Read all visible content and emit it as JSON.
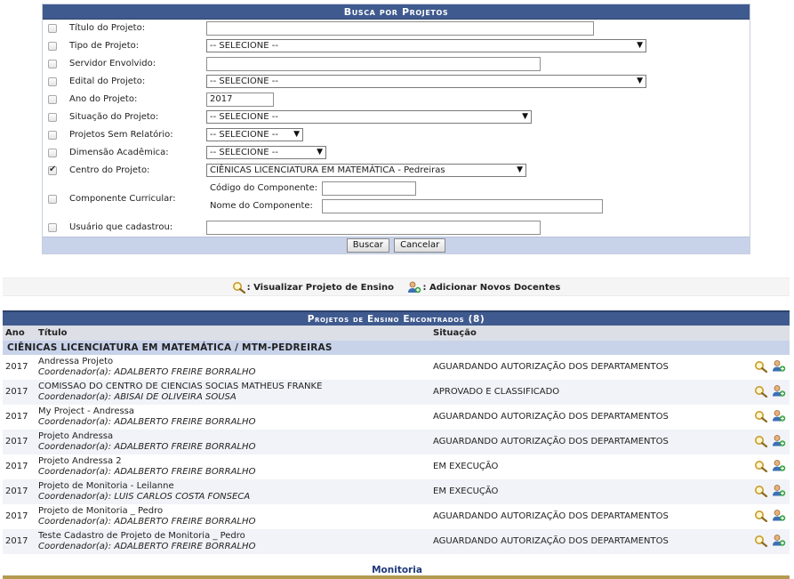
{
  "form": {
    "title": "Busca por Projetos",
    "fields": {
      "titulo": {
        "label": "Título do Projeto:",
        "value": ""
      },
      "tipo": {
        "label": "Tipo de Projeto:",
        "value": "-- SELECIONE --"
      },
      "servidor": {
        "label": "Servidor Envolvido:",
        "value": ""
      },
      "edital": {
        "label": "Edital do Projeto:",
        "value": "-- SELECIONE --"
      },
      "ano": {
        "label": "Ano do Projeto:",
        "value": "2017"
      },
      "situacao": {
        "label": "Situação do Projeto:",
        "value": "-- SELECIONE --"
      },
      "sem_relatorio": {
        "label": "Projetos Sem Relatório:",
        "value": "-- SELECIONE --"
      },
      "dimensao": {
        "label": "Dimensão Acadêmica:",
        "value": "-- SELECIONE --"
      },
      "centro": {
        "label": "Centro do Projeto:",
        "value": "CIÊNICAS LICENCIATURA EM MATEMÁTICA - Pedreiras",
        "checked": true
      },
      "componente": {
        "label": "Componente Curricular:",
        "codigo_label": "Código do Componente:",
        "nome_label": "Nome do Componente:"
      },
      "usuario": {
        "label": "Usuário que cadastrou:",
        "value": ""
      }
    },
    "buttons": {
      "buscar": "Buscar",
      "cancelar": "Cancelar"
    }
  },
  "legend": {
    "view": ": Visualizar Projeto de Ensino",
    "add": ": Adicionar Novos Docentes"
  },
  "results": {
    "title": "Projetos de Ensino Encontrados (8)",
    "headers": {
      "ano": "Ano",
      "titulo": "Título",
      "situacao": "Situação"
    },
    "group": "CIÊNICAS LICENCIATURA EM MATEMÁTICA / MTM-PEDREIRAS",
    "rows": [
      {
        "ano": "2017",
        "titulo": "Andressa Projeto",
        "coord": "Coordenador(a): ADALBERTO FREIRE BORRALHO",
        "situacao": "AGUARDANDO AUTORIZAÇÃO DOS DEPARTAMENTOS"
      },
      {
        "ano": "2017",
        "titulo": "COMISSAO DO CENTRO DE CIENCIAS SOCIAS MATHEUS FRANKE",
        "coord": "Coordenador(a): ABISAI DE OLIVEIRA SOUSA",
        "situacao": "APROVADO E CLASSIFICADO"
      },
      {
        "ano": "2017",
        "titulo": "My Project - Andressa",
        "coord": "Coordenador(a): ADALBERTO FREIRE BORRALHO",
        "situacao": "AGUARDANDO AUTORIZAÇÃO DOS DEPARTAMENTOS"
      },
      {
        "ano": "2017",
        "titulo": "Projeto Andressa",
        "coord": "Coordenador(a): ADALBERTO FREIRE BORRALHO",
        "situacao": "AGUARDANDO AUTORIZAÇÃO DOS DEPARTAMENTOS"
      },
      {
        "ano": "2017",
        "titulo": "Projeto Andressa 2",
        "coord": "Coordenador(a): ADALBERTO FREIRE BORRALHO",
        "situacao": "EM EXECUÇÃO"
      },
      {
        "ano": "2017",
        "titulo": "Projeto de Monitoria - Leilanne",
        "coord": "Coordenador(a): LUIS CARLOS COSTA FONSECA",
        "situacao": "EM EXECUÇÃO"
      },
      {
        "ano": "2017",
        "titulo": "Projeto de Monitoria _ Pedro",
        "coord": "Coordenador(a): ADALBERTO FREIRE BORRALHO",
        "situacao": "AGUARDANDO AUTORIZAÇÃO DOS DEPARTAMENTOS"
      },
      {
        "ano": "2017",
        "titulo": "Teste Cadastro de Projeto de Monitoria _ Pedro",
        "coord": "Coordenador(a): ADALBERTO FREIRE BORRALHO",
        "situacao": "AGUARDANDO AUTORIZAÇÃO DOS DEPARTAMENTOS"
      }
    ]
  },
  "footer": {
    "link": "Monitoria"
  },
  "colors": {
    "header_blue": "#3f5a8e",
    "band_blue": "#c8d3ea",
    "footer_gold": "#b49b52"
  }
}
